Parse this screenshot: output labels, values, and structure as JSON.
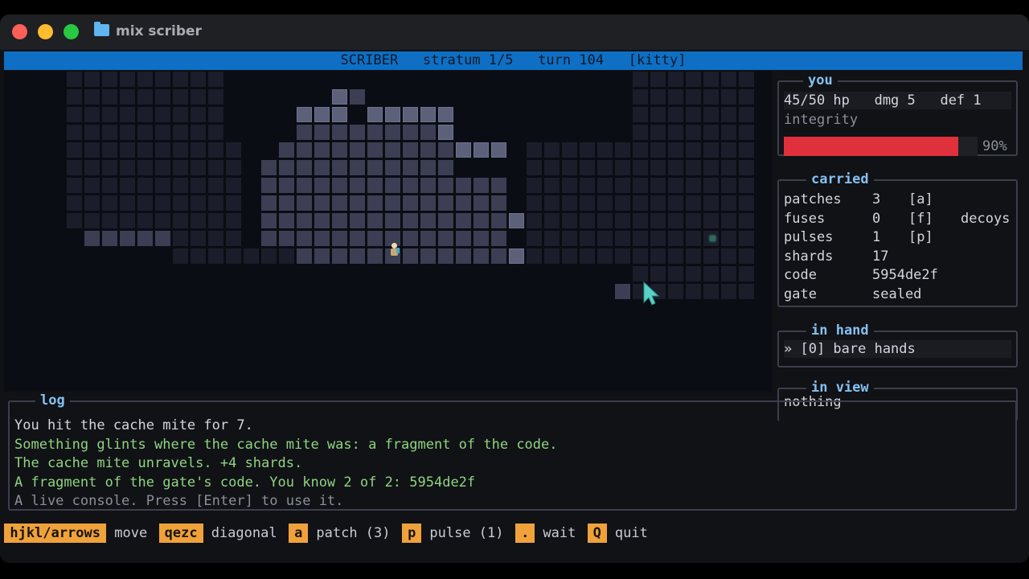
{
  "window": {
    "title": "mix scriber"
  },
  "statusbar": {
    "text": "SCRIBER   stratum 1/5   turn 104   [kitty]"
  },
  "you": {
    "title": "you",
    "stats": "45/50 hp   dmg 5   def 1",
    "integrity_label": "integrity",
    "integrity_percent": "90%",
    "integrity_fraction": 0.9,
    "integrity_color": "#e0303b"
  },
  "carried": {
    "title": "carried",
    "rows": [
      {
        "name": "patches",
        "value": "3",
        "key": "[a]",
        "extra": ""
      },
      {
        "name": "fuses",
        "value": "0",
        "key": "[f]",
        "extra": "decoys"
      },
      {
        "name": "pulses",
        "value": "1",
        "key": "[p]",
        "extra": ""
      },
      {
        "name": "shards",
        "value": "17",
        "key": "",
        "extra": ""
      },
      {
        "name": "code",
        "value": "5954de2f",
        "key": "",
        "extra": ""
      },
      {
        "name": "gate",
        "value": "sealed",
        "key": "",
        "extra": ""
      }
    ]
  },
  "in_hand": {
    "title": "in hand",
    "item": "» [0] bare hands"
  },
  "in_view": {
    "title": "in view",
    "text": "nothing"
  },
  "log": {
    "title": "log",
    "lines": [
      {
        "text": "You hit the cache mite for 7.",
        "color": "#d3d6dc"
      },
      {
        "text": "Something glints where the cache mite was: a fragment of the code.",
        "color": "#8fd47f"
      },
      {
        "text": "The cache mite unravels. +4 shards.",
        "color": "#8fd47f"
      },
      {
        "text": "A fragment of the gate's code. You know 2 of 2: 5954de2f",
        "color": "#8fd47f"
      },
      {
        "text": "A live console. Press [Enter] to use it.",
        "color": "#8b8f99"
      }
    ]
  },
  "controls": [
    {
      "key": "hjkl/arrows",
      "label": "move"
    },
    {
      "key": "qezc",
      "label": "diagonal"
    },
    {
      "key": "a",
      "label": "patch (3)"
    },
    {
      "key": "p",
      "label": "pulse (1)"
    },
    {
      "key": ".",
      "label": "wait"
    },
    {
      "key": "Q",
      "label": "quit"
    }
  ],
  "colors": {
    "accent_blue": "#0e6fc4",
    "key_orange": "#f0a23a",
    "panel_title": "#86c0f0"
  }
}
